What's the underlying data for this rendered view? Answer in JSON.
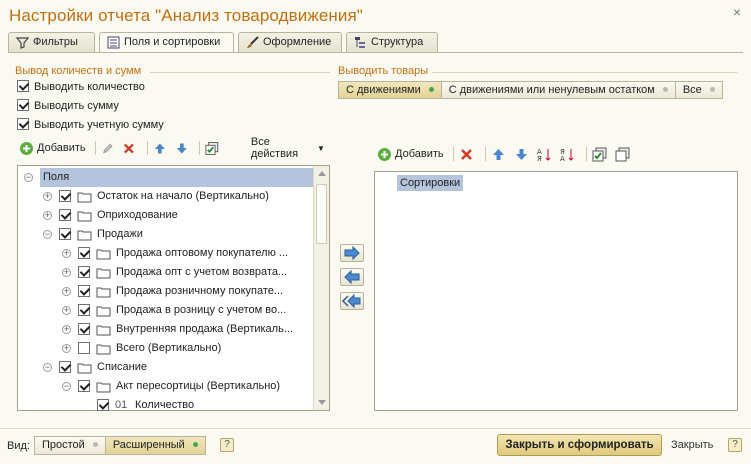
{
  "window": {
    "title": "Настройки отчета \"Анализ товародвижения\""
  },
  "tabs": [
    {
      "label": "Фильтры",
      "icon": "filter-icon"
    },
    {
      "label": "Поля и сортировки",
      "icon": "fields-icon",
      "active": true
    },
    {
      "label": "Оформление",
      "icon": "brush-icon"
    },
    {
      "label": "Структура",
      "icon": "structure-icon"
    }
  ],
  "left_group": {
    "title": "Вывод количеств и сумм",
    "options": [
      {
        "label": "Выводить количество",
        "checked": true
      },
      {
        "label": "Выводить сумму",
        "checked": true
      },
      {
        "label": "Выводить учетную сумму",
        "checked": true
      }
    ]
  },
  "right_group": {
    "title": "Выводить товары",
    "options": [
      {
        "label": "С движениями",
        "selected": true
      },
      {
        "label": "С движениями или ненулевым остатком",
        "selected": false
      },
      {
        "label": "Все",
        "selected": false
      }
    ]
  },
  "fields_toolbar": {
    "add_label": "Добавить",
    "all_actions_label": "Все действия"
  },
  "sort_toolbar": {
    "add_label": "Добавить"
  },
  "fields_tree": [
    {
      "label": "Поля",
      "level": 0,
      "expander": "minus",
      "checkbox": false,
      "folder": false,
      "selected": true
    },
    {
      "label": "Остаток на начало (Вертикально)",
      "level": 1,
      "expander": "plus",
      "checkbox": true,
      "folder": true
    },
    {
      "label": "Оприходование",
      "level": 1,
      "expander": "plus",
      "checkbox": true,
      "folder": true
    },
    {
      "label": "Продажи",
      "level": 1,
      "expander": "minus",
      "checkbox": true,
      "folder": true
    },
    {
      "label": "Продажа оптовому покупателю ...",
      "level": 2,
      "expander": "plus",
      "checkbox": true,
      "folder": true
    },
    {
      "label": "Продажа опт с учетом возврата...",
      "level": 2,
      "expander": "plus",
      "checkbox": true,
      "folder": true
    },
    {
      "label": "Продажа розничному покупате...",
      "level": 2,
      "expander": "plus",
      "checkbox": true,
      "folder": true
    },
    {
      "label": "Продажа в розницу с учетом во...",
      "level": 2,
      "expander": "plus",
      "checkbox": true,
      "folder": true
    },
    {
      "label": "Внутренняя продажа (Вертикаль...",
      "level": 2,
      "expander": "plus",
      "checkbox": true,
      "folder": true
    },
    {
      "label": "Всего (Вертикально)",
      "level": 2,
      "expander": "plus",
      "checkbox": false,
      "folder": true
    },
    {
      "label": "Списание",
      "level": 1,
      "expander": "minus",
      "checkbox": true,
      "folder": true
    },
    {
      "label": "Акт пересортицы (Вертикально)",
      "level": 2,
      "expander": "minus",
      "checkbox": true,
      "folder": true
    },
    {
      "label": "Количество",
      "level": 3,
      "expander": "none",
      "checkbox": true,
      "folder": false,
      "prefix": "01"
    }
  ],
  "sort_tree": [
    {
      "label": "Сортировки",
      "selected": true
    }
  ],
  "footer": {
    "view_label": "Вид:",
    "view_options": [
      {
        "label": "Простой",
        "selected": false
      },
      {
        "label": "Расширенный",
        "selected": true
      }
    ],
    "help_label": "?",
    "primary_label": "Закрыть и сформировать",
    "close_label": "Закрыть"
  },
  "colors": {
    "title": "#c2700f",
    "accent_green": "#4aa64a",
    "selection": "#b4c4dc"
  }
}
